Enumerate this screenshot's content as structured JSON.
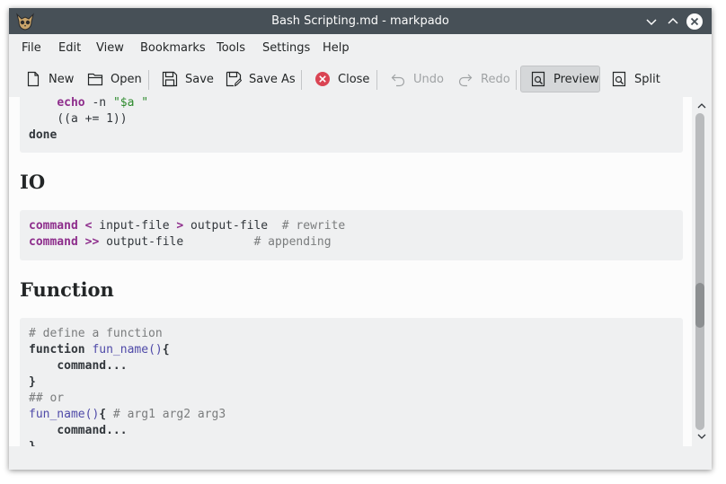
{
  "window": {
    "title": "Bash Scripting.md - markpado"
  },
  "menubar": {
    "items": [
      "File",
      "Edit",
      "View",
      "Bookmarks",
      "Tools",
      "Settings",
      "Help"
    ]
  },
  "toolbar": {
    "new_label": "New",
    "open_label": "Open",
    "save_label": "Save",
    "save_as_label": "Save As",
    "close_label": "Close",
    "undo_label": "Undo",
    "redo_label": "Redo",
    "preview_label": "Preview",
    "split_label": "Split",
    "undo_enabled": false,
    "redo_enabled": false,
    "preview_active": true
  },
  "document": {
    "block1": {
      "line1": {
        "cmd": "echo",
        "args": " -n ",
        "str": "\"$a \""
      },
      "line2": "((a += 1))",
      "line3": "done"
    },
    "heading_io": "IO",
    "block2": {
      "line1": {
        "cmd": "command",
        "op1": "<",
        "a1": " input-file ",
        "op2": ">",
        "a2": " output-file  ",
        "comment": "# rewrite"
      },
      "line2": {
        "cmd": "command",
        "op1": ">>",
        "a1": " output-file          ",
        "comment": "# appending"
      }
    },
    "heading_function": "Function",
    "block3": {
      "line1": "# define a function",
      "line2": {
        "kw": "function",
        "fn": " fun_name()",
        "brace": "{"
      },
      "line3": "command...",
      "line4": "}",
      "line5": "## or",
      "line6": {
        "fn": "fun_name()",
        "brace": "{",
        "comment": " # arg1 arg2 arg3"
      },
      "line7": "command...",
      "line8": "}"
    }
  },
  "colors": {
    "titlebar": "#475057",
    "keyword_purple": "#8e2e8c",
    "string_green": "#2c8a2c",
    "close_red": "#da4453"
  }
}
